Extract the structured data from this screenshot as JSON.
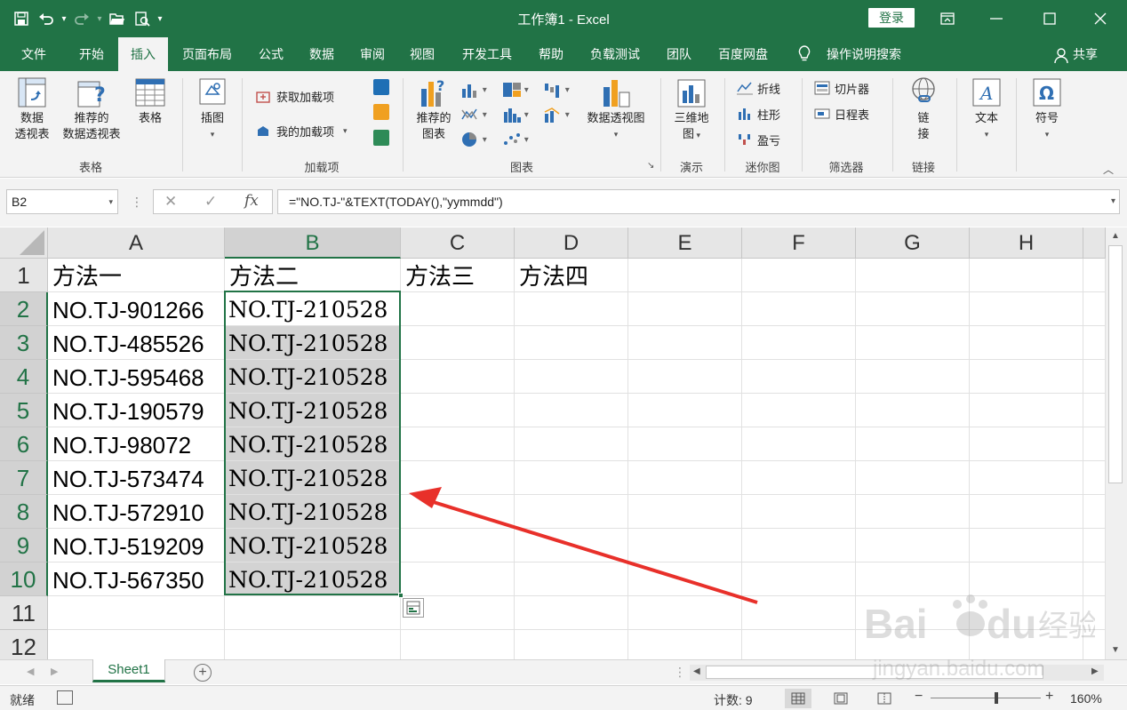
{
  "window": {
    "title": "工作簿1 - Excel",
    "login_label": "登录",
    "ribbon_display_icon": "ribbon-display-options-icon",
    "minimize_icon": "minimize-icon",
    "maximize_icon": "maximize-icon",
    "close_icon": "close-icon"
  },
  "quick_access": {
    "save_icon": "save-icon",
    "undo_icon": "undo-icon",
    "redo_icon": "redo-icon",
    "open_icon": "open-folder-icon",
    "print_preview_icon": "print-preview-icon",
    "customize_icon": "customize-qat-icon"
  },
  "tabs": [
    "文件",
    "开始",
    "插入",
    "页面布局",
    "公式",
    "数据",
    "审阅",
    "视图",
    "开发工具",
    "帮助",
    "负载测试",
    "团队",
    "百度网盘"
  ],
  "active_tab": "插入",
  "tell_me": "操作说明搜索",
  "share": "共享",
  "ribbon": {
    "groups": {
      "tables": "表格",
      "addins": "加载项",
      "charts": "图表",
      "tours": "演示",
      "sparklines": "迷你图",
      "filters": "筛选器",
      "links": "链接"
    },
    "buttons": {
      "pivot_table": [
        "数据",
        "透视表"
      ],
      "recommended_pivot": [
        "推荐的",
        "数据透视表"
      ],
      "table": "表格",
      "illustrations": "插图",
      "get_addins": "获取加载项",
      "my_addins": "我的加载项",
      "recommended_charts": [
        "推荐的",
        "图表"
      ],
      "pivot_chart": "数据透视图",
      "map_3d": [
        "三维地",
        "图"
      ],
      "line": "折线",
      "column": "柱形",
      "win_loss": "盈亏",
      "slicer": "切片器",
      "timeline": "日程表",
      "link": [
        "链",
        "接"
      ],
      "text": "文本",
      "symbol": "符号"
    }
  },
  "formula_bar": {
    "name_box": "B2",
    "cancel": "✕",
    "enter": "✓",
    "fx": "fx",
    "formula": "=\"NO.TJ-\"&TEXT(TODAY(),\"yymmdd\")"
  },
  "grid": {
    "columns": [
      "A",
      "B",
      "C",
      "D",
      "E",
      "F",
      "G",
      "H"
    ],
    "selected_column": "B",
    "rows": [
      "1",
      "2",
      "3",
      "4",
      "5",
      "6",
      "7",
      "8",
      "9",
      "10",
      "11",
      "12"
    ],
    "header_row": [
      "方法一",
      "方法二",
      "方法三",
      "方法四"
    ],
    "column_a": [
      "NO.TJ-901266",
      "NO.TJ-485526",
      "NO.TJ-595468",
      "NO.TJ-190579",
      "NO.TJ-98072",
      "NO.TJ-573474",
      "NO.TJ-572910",
      "NO.TJ-519209",
      "NO.TJ-567350"
    ],
    "column_b": [
      "NO.TJ-210528",
      "NO.TJ-210528",
      "NO.TJ-210528",
      "NO.TJ-210528",
      "NO.TJ-210528",
      "NO.TJ-210528",
      "NO.TJ-210528",
      "NO.TJ-210528",
      "NO.TJ-210528"
    ]
  },
  "sheets": [
    "Sheet1"
  ],
  "status": {
    "ready": "就绪",
    "count": "计数: 9",
    "zoom_level": "160%",
    "zoom": 1.6
  },
  "watermark": {
    "logo": "Bai du 经验",
    "url": "jingyan.baidu.com"
  },
  "colors": {
    "brand": "#217346",
    "selection_fill": "#d3d3d3",
    "annotation_arrow": "#e8302a"
  }
}
